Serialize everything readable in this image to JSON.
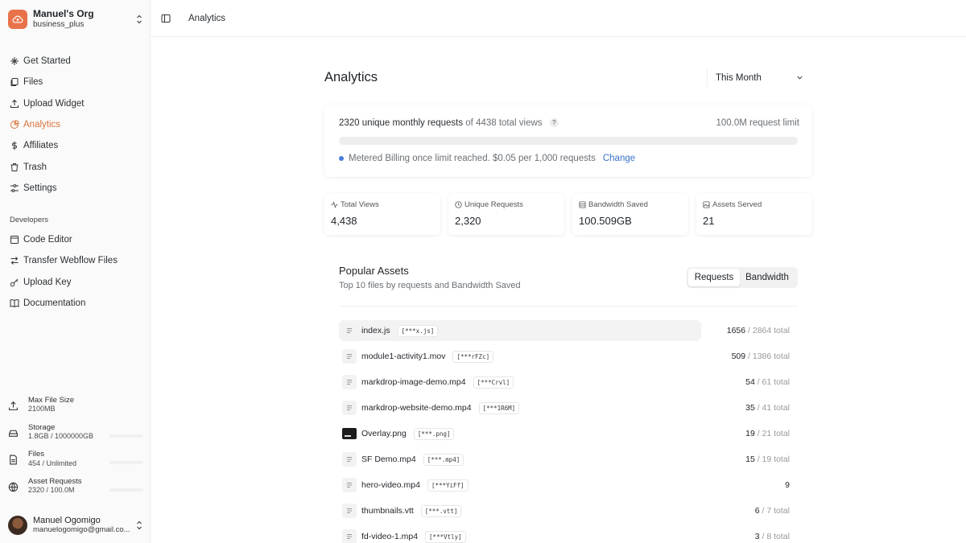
{
  "org": {
    "name": "Manuel's Org",
    "plan": "business_plus"
  },
  "nav": [
    {
      "label": "Get Started",
      "icon": "sparkle-icon",
      "active": false
    },
    {
      "label": "Files",
      "icon": "files-icon",
      "active": false
    },
    {
      "label": "Upload Widget",
      "icon": "upload-icon",
      "active": false
    },
    {
      "label": "Analytics",
      "icon": "analytics-icon",
      "active": true
    },
    {
      "label": "Affiliates",
      "icon": "dollar-icon",
      "active": false
    },
    {
      "label": "Trash",
      "icon": "trash-icon",
      "active": false
    },
    {
      "label": "Settings",
      "icon": "settings-icon",
      "active": false
    }
  ],
  "developers": {
    "heading": "Developers",
    "items": [
      {
        "label": "Code Editor",
        "icon": "code-editor-icon"
      },
      {
        "label": "Transfer Webflow Files",
        "icon": "transfer-icon"
      },
      {
        "label": "Upload Key",
        "icon": "key-icon"
      },
      {
        "label": "Documentation",
        "icon": "book-icon"
      }
    ]
  },
  "usage": [
    {
      "label": "Max File Size",
      "value": "2100MB",
      "icon": "upload-icon"
    },
    {
      "label": "Storage",
      "value": "1.8GB / 1000000GB",
      "icon": "storage-icon"
    },
    {
      "label": "Files",
      "value": "454 / Unlimited",
      "icon": "file-icon"
    },
    {
      "label": "Asset Requests",
      "value": "2320 / 100.0M",
      "icon": "globe-icon"
    }
  ],
  "user": {
    "name": "Manuel Ogomigo",
    "email": "manuelogomigo@gmail.co..."
  },
  "topbar": {
    "title": "Analytics"
  },
  "page": {
    "title": "Analytics",
    "range": "This Month"
  },
  "limits": {
    "unique_text": "2320 unique monthly requests",
    "of_text": "of 4438 total views",
    "help": "?",
    "limit_text": "100.0M request limit",
    "progress_fraction": 2.32e-05,
    "billing_text": "Metered Billing once limit reached. $0.05 per 1,000 requests",
    "change_label": "Change"
  },
  "stats": [
    {
      "label": "Total Views",
      "value": "4,438",
      "icon": "activity-icon"
    },
    {
      "label": "Unique Requests",
      "value": "2,320",
      "icon": "clock-icon"
    },
    {
      "label": "Bandwidth Saved",
      "value": "100.509GB",
      "icon": "database-icon"
    },
    {
      "label": "Assets Served",
      "value": "21",
      "icon": "image-icon"
    }
  ],
  "popular": {
    "title": "Popular Assets",
    "subtitle": "Top 10 files by requests and Bandwidth Saved",
    "tabs": {
      "requests": "Requests",
      "bandwidth": "Bandwidth"
    },
    "assets": [
      {
        "name": "index.js",
        "tag": "[***x.js]",
        "count": "1656",
        "total": "/ 2864 total",
        "thumb": false
      },
      {
        "name": "module1-activity1.mov",
        "tag": "[***rFZc]",
        "count": "509",
        "total": "/ 1386 total",
        "thumb": false
      },
      {
        "name": "markdrop-image-demo.mp4",
        "tag": "[***Crvl]",
        "count": "54",
        "total": "/ 61 total",
        "thumb": false
      },
      {
        "name": "markdrop-website-demo.mp4",
        "tag": "[***1R6M]",
        "count": "35",
        "total": "/ 41 total",
        "thumb": false
      },
      {
        "name": "Overlay.png",
        "tag": "[***.png]",
        "count": "19",
        "total": "/ 21 total",
        "thumb": true
      },
      {
        "name": "SF Demo.mp4",
        "tag": "[***.mp4]",
        "count": "15",
        "total": "/ 19 total",
        "thumb": false
      },
      {
        "name": "hero-video.mp4",
        "tag": "[***YiFf]",
        "count": "9",
        "total": "",
        "thumb": false
      },
      {
        "name": "thumbnails.vtt",
        "tag": "[***.vtt]",
        "count": "6",
        "total": "/ 7 total",
        "thumb": false
      },
      {
        "name": "fd-video-1.mp4",
        "tag": "[***Vtly]",
        "count": "3",
        "total": "/ 8 total",
        "thumb": false
      }
    ]
  },
  "colors": {
    "accent": "#d9743b",
    "link": "#3b73c8",
    "progress": "#4a7bd8"
  }
}
